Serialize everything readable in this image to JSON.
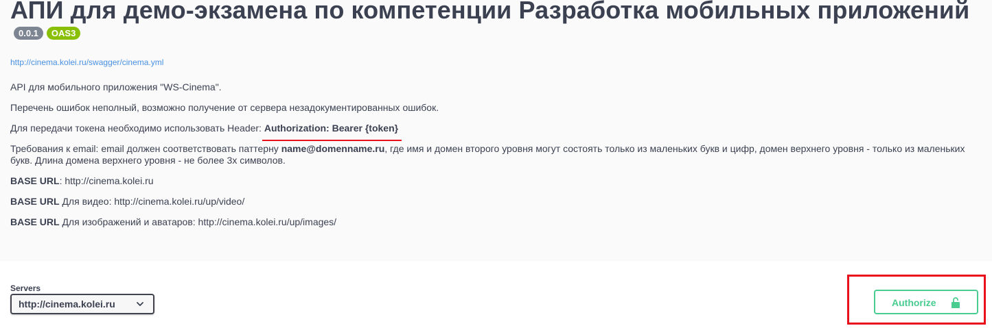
{
  "info": {
    "title": "АПИ для демо-экзамена по компетенции Разработка мобильных приложений",
    "version_badge": "0.0.1",
    "oas_badge": "OAS3",
    "spec_url": "http://cinema.kolei.ru/swagger/cinema.yml"
  },
  "description": {
    "p1": "API для мобильного приложения \"WS-Cinema\".",
    "p2": "Перечень ошибок неполный, возможно получение от сервера незадокументированных ошибок.",
    "p3_text": "Для передачи токена необходимо использовать Header: ",
    "p3_bold": "Authorization: Bearer {token}",
    "p4_text1": "Требования к email: email должен соответствовать паттерну ",
    "p4_bold": "name@domenname.ru",
    "p4_text2": ", где имя и домен второго уровня могут состоять только из маленьких букв и цифр, домен верхнего уровня - только из маленьких букв. Длина домена верхнего уровня - не более 3х символов.",
    "base1_bold": "BASE URL",
    "base1_text": ": http://cinema.kolei.ru",
    "base2_bold": "BASE URL",
    "base2_text": " Для видео: http://cinema.kolei.ru/up/video/",
    "base3_bold": "BASE URL",
    "base3_text": " Для изображений и аватаров: http://cinema.kolei.ru/up/images/"
  },
  "servers": {
    "label": "Servers",
    "selected": "http://cinema.kolei.ru"
  },
  "authorize": {
    "label": "Authorize",
    "color": "#49cc90"
  },
  "icons": {
    "select_chevron": "chevron-down-icon",
    "authorize_lock": "unlocked-icon"
  },
  "annotations": {
    "highlight_color": "#e8101a"
  }
}
